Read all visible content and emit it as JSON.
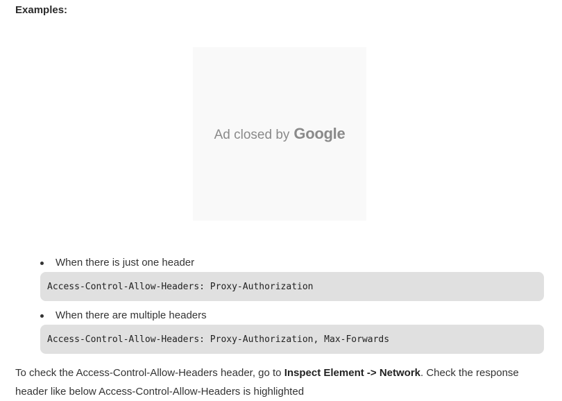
{
  "heading": "Examples:",
  "ad": {
    "prefix": "Ad closed by",
    "brand": "Google"
  },
  "examples": [
    {
      "description": "When there is just one header",
      "code": "Access-Control-Allow-Headers: Proxy-Authorization"
    },
    {
      "description": "When there are multiple headers",
      "code": "Access-Control-Allow-Headers: Proxy-Authorization, Max-Forwards"
    }
  ],
  "paragraph": {
    "before": "To check the Access-Control-Allow-Headers header, go to ",
    "emphasis": "Inspect Element -> Network",
    "after": ". Check the response header like below Access-Control-Allow-Headers is highlighted"
  }
}
